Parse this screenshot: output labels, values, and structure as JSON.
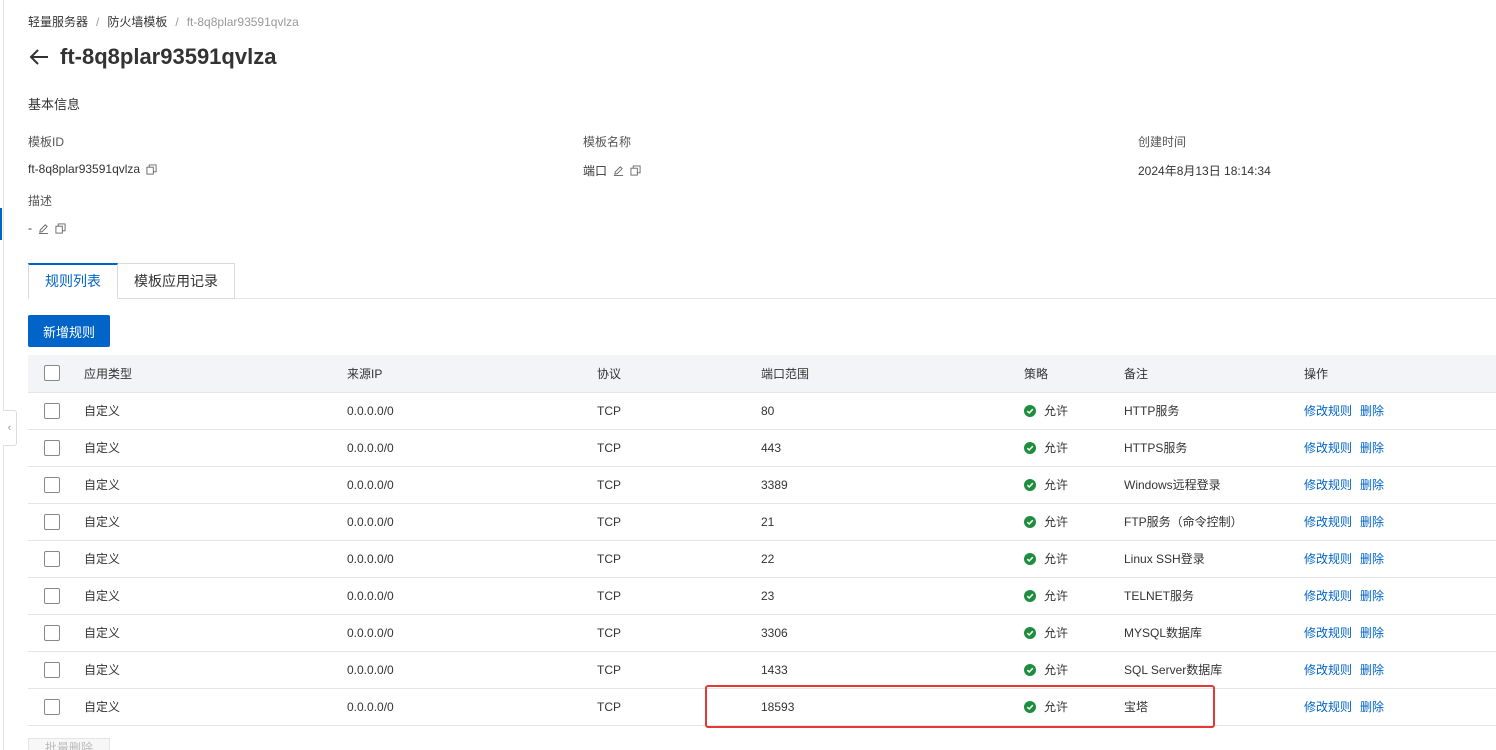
{
  "breadcrumb": {
    "items": [
      "轻量服务器",
      "防火墙模板"
    ],
    "current": "ft-8q8plar93591qvlza"
  },
  "header": {
    "title": "ft-8q8plar93591qvlza"
  },
  "basic_info": {
    "section_title": "基本信息",
    "template_id_label": "模板ID",
    "template_id_value": "ft-8q8plar93591qvlza",
    "template_name_label": "模板名称",
    "template_name_value": "端口",
    "created_label": "创建时间",
    "created_value": "2024年8月13日 18:14:34",
    "description_label": "描述",
    "description_value": "-"
  },
  "tabs": [
    "规则列表",
    "模板应用记录"
  ],
  "toolbar": {
    "add_rule_label": "新增规则",
    "bulk_delete_label": "批量删除"
  },
  "table": {
    "columns": [
      "应用类型",
      "来源IP",
      "协议",
      "端口范围",
      "策略",
      "备注",
      "操作"
    ],
    "rows": [
      {
        "type": "自定义",
        "source": "0.0.0.0/0",
        "protocol": "TCP",
        "port": "80",
        "policy": "允许",
        "note": "HTTP服务"
      },
      {
        "type": "自定义",
        "source": "0.0.0.0/0",
        "protocol": "TCP",
        "port": "443",
        "policy": "允许",
        "note": "HTTPS服务"
      },
      {
        "type": "自定义",
        "source": "0.0.0.0/0",
        "protocol": "TCP",
        "port": "3389",
        "policy": "允许",
        "note": "Windows远程登录"
      },
      {
        "type": "自定义",
        "source": "0.0.0.0/0",
        "protocol": "TCP",
        "port": "21",
        "policy": "允许",
        "note": "FTP服务（命令控制）"
      },
      {
        "type": "自定义",
        "source": "0.0.0.0/0",
        "protocol": "TCP",
        "port": "22",
        "policy": "允许",
        "note": "Linux SSH登录"
      },
      {
        "type": "自定义",
        "source": "0.0.0.0/0",
        "protocol": "TCP",
        "port": "23",
        "policy": "允许",
        "note": "TELNET服务"
      },
      {
        "type": "自定义",
        "source": "0.0.0.0/0",
        "protocol": "TCP",
        "port": "3306",
        "policy": "允许",
        "note": "MYSQL数据库"
      },
      {
        "type": "自定义",
        "source": "0.0.0.0/0",
        "protocol": "TCP",
        "port": "1433",
        "policy": "允许",
        "note": "SQL Server数据库"
      },
      {
        "type": "自定义",
        "source": "0.0.0.0/0",
        "protocol": "TCP",
        "port": "18593",
        "policy": "允许",
        "note": "宝塔"
      }
    ],
    "actions": {
      "edit": "修改规则",
      "delete": "删除"
    }
  },
  "colors": {
    "accent": "#0064c8",
    "success": "#1e8e3e",
    "highlight": "#e53935"
  }
}
